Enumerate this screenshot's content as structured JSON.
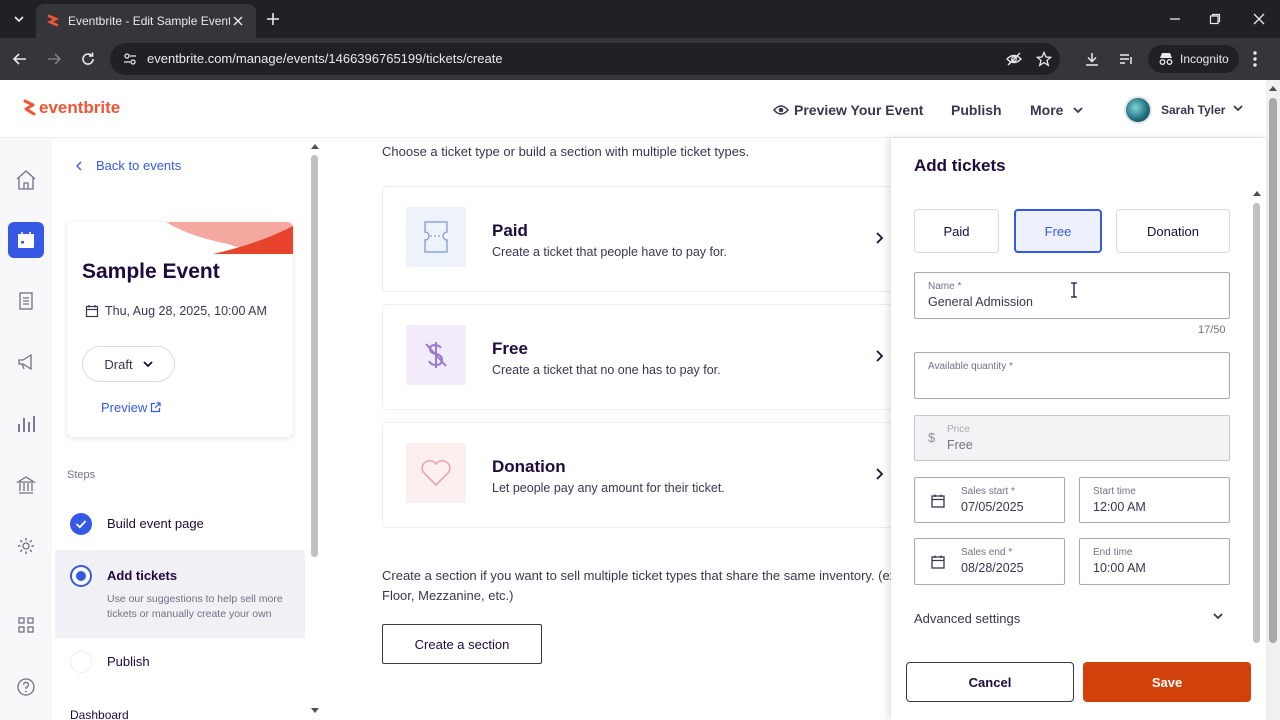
{
  "browser": {
    "tab_title": "Eventbrite - Edit Sample Event",
    "url": "eventbrite.com/manage/events/1466396765199/tickets/create",
    "incognito_label": "Incognito"
  },
  "header": {
    "logo": "eventbrite",
    "preview_label": "Preview Your Event",
    "publish_label": "Publish",
    "more_label": "More",
    "user_name": "Sarah Tyler"
  },
  "sidebar": {
    "back_label": "Back to events",
    "event_title": "Sample Event",
    "event_date": "Thu, Aug 28, 2025, 10:00 AM",
    "status": "Draft",
    "preview_label": "Preview",
    "steps_label": "Steps",
    "steps": [
      {
        "label": "Build event page",
        "state": "done"
      },
      {
        "label": "Add tickets",
        "state": "current",
        "sub": "Use our suggestions to help sell more tickets or manually create your own"
      },
      {
        "label": "Publish",
        "state": "todo"
      }
    ],
    "dashboard_label": "Dashboard"
  },
  "main": {
    "intro": "Choose a ticket type or build a section with multiple ticket types.",
    "ticket_types": [
      {
        "title": "Paid",
        "desc": "Create a ticket that people have to pay for.",
        "icon": "ticket-icon"
      },
      {
        "title": "Free",
        "desc": "Create a ticket that no one has to pay for.",
        "icon": "no-dollar-icon"
      },
      {
        "title": "Donation",
        "desc": "Let people pay any amount for their ticket.",
        "icon": "heart-icon"
      }
    ],
    "section_text": "Create a section if you want to sell multiple ticket types that share the same inventory. (ex Floor, Mezzanine, etc.)",
    "create_section_label": "Create a section"
  },
  "drawer": {
    "title": "Add tickets",
    "types": [
      "Paid",
      "Free",
      "Donation"
    ],
    "active_type": "Free",
    "name_label": "Name *",
    "name_value": "General Admission",
    "name_count": "17/50",
    "quantity_label": "Available quantity *",
    "quantity_value": "",
    "currency_symbol": "$",
    "price_label": "Price",
    "price_value": "Free",
    "sales_start_label": "Sales start *",
    "sales_start_value": "07/05/2025",
    "start_time_label": "Start time",
    "start_time_value": "12:00 AM",
    "sales_end_label": "Sales end *",
    "sales_end_value": "08/28/2025",
    "end_time_label": "End time",
    "end_time_value": "10:00 AM",
    "advanced_label": "Advanced settings",
    "cancel_label": "Cancel",
    "save_label": "Save"
  },
  "colors": {
    "brand": "#f05537",
    "accent": "#3659e3",
    "save": "#d1410c"
  }
}
